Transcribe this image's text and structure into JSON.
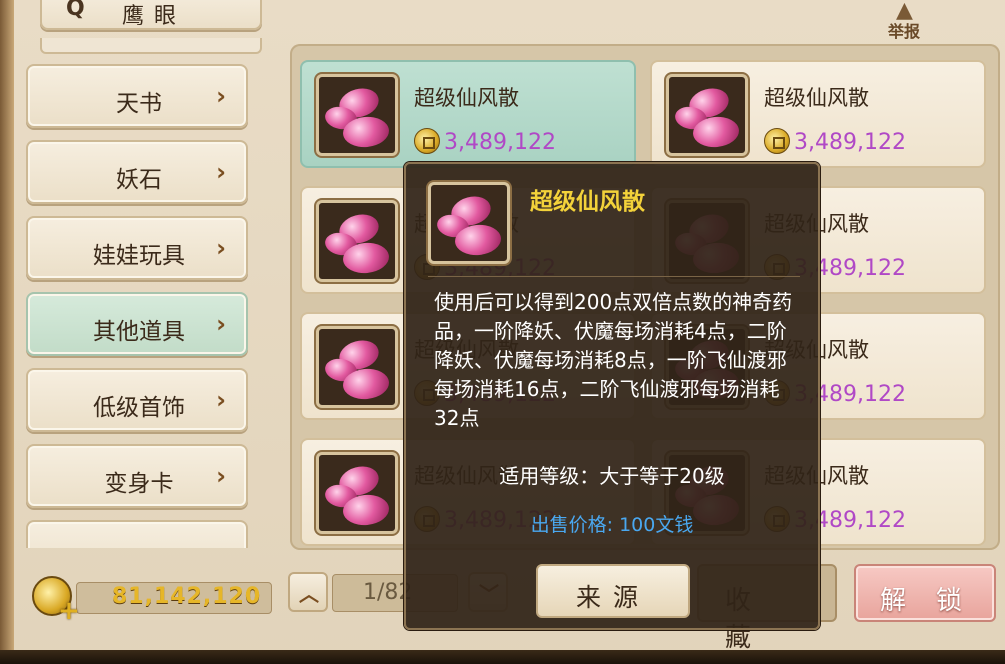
{
  "search": {
    "label": "鹰眼"
  },
  "report": {
    "label": "举报"
  },
  "categories": [
    {
      "label": "天书",
      "selected": false
    },
    {
      "label": "妖石",
      "selected": false
    },
    {
      "label": "娃娃玩具",
      "selected": false
    },
    {
      "label": "其他道具",
      "selected": true
    },
    {
      "label": "低级首饰",
      "selected": false
    },
    {
      "label": "变身卡",
      "selected": false
    }
  ],
  "items": [
    {
      "name": "超级仙风散",
      "price": "3,489,122",
      "selected": true
    },
    {
      "name": "超级仙风散",
      "price": "3,489,122",
      "selected": false
    },
    {
      "name": "超级仙风散",
      "price": "3,489,122",
      "selected": false
    },
    {
      "name": "超级仙风散",
      "price": "3,489,122",
      "selected": false
    },
    {
      "name": "超级仙风散",
      "price": "3,489,122",
      "selected": false
    },
    {
      "name": "超级仙风散",
      "price": "3,489,122",
      "selected": false
    },
    {
      "name": "超级仙风散",
      "price": "3,489,122",
      "selected": false
    },
    {
      "name": "超级仙风散",
      "price": "3,489,122",
      "selected": false
    }
  ],
  "wallet": {
    "amount": "81,142,120"
  },
  "pagination": {
    "display": "1/82"
  },
  "buttons": {
    "favorite": "收藏",
    "unlock": "解锁"
  },
  "tooltip": {
    "name": "超级仙风散",
    "description": "使用后可以得到200点双倍点数的神奇药品，一阶降妖、伏魔每场消耗4点，二阶降妖、伏魔每场消耗8点，一阶飞仙渡邪每场消耗16点，二阶飞仙渡邪每场消耗32点",
    "level": "适用等级：大于等于20级",
    "sell_price": "出售价格: 100文钱",
    "source_button": "来源"
  },
  "colors": {
    "price": "#b048c6",
    "tooltip_title": "#f3d23a",
    "sell_price": "#4aa8f0",
    "wallet": "#e6b628",
    "selected_tab": "#c2dcc8"
  },
  "icons": [
    "search-icon",
    "chevron-right-icon",
    "warning-icon",
    "gold-coin-icon",
    "chevron-up-icon",
    "chevron-down-icon",
    "gem-icon"
  ]
}
